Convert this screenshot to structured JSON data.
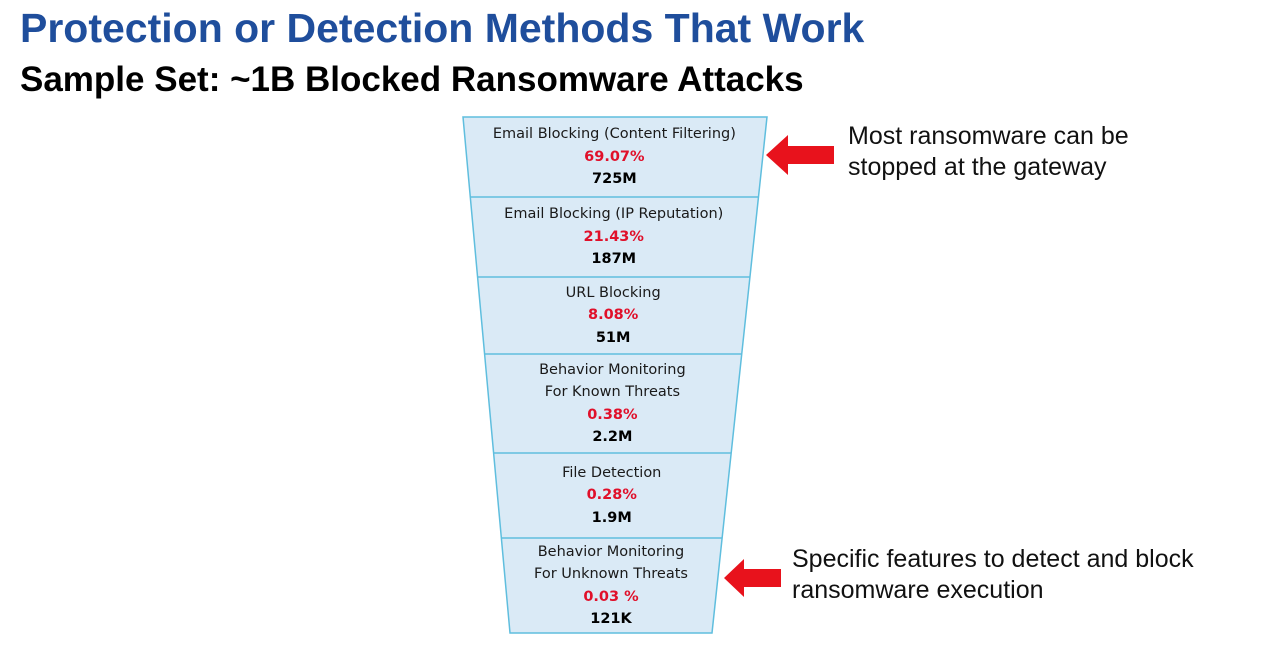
{
  "title": "Protection or Detection Methods That Work",
  "subtitle": "Sample Set: ~1B Blocked Ransomware Attacks",
  "colors": {
    "title": "#1f4e9c",
    "percent": "#e0102a",
    "funnel_fill": "#daeaf6",
    "funnel_line": "#5fbede",
    "arrow": "#e8121c"
  },
  "funnel": [
    {
      "label_lines": [
        "Email Blocking (Content Filtering)"
      ],
      "percent": "69.07%",
      "count": "725M"
    },
    {
      "label_lines": [
        "Email Blocking (IP Reputation)"
      ],
      "percent": "21.43%",
      "count": "187M"
    },
    {
      "label_lines": [
        "URL Blocking"
      ],
      "percent": "8.08%",
      "count": "51M"
    },
    {
      "label_lines": [
        "Behavior Monitoring",
        "For Known Threats"
      ],
      "percent": "0.38%",
      "count": "2.2M"
    },
    {
      "label_lines": [
        "File Detection"
      ],
      "percent": "0.28%",
      "count": "1.9M"
    },
    {
      "label_lines": [
        "Behavior Monitoring",
        "For Unknown Threats"
      ],
      "percent": "0.03 %",
      "count": "121K"
    }
  ],
  "annotations": {
    "gateway": {
      "lines": [
        "Most ransomware can be",
        "stopped at the gateway"
      ],
      "icon": "left-arrow-icon"
    },
    "execution": {
      "lines": [
        "Specific features to detect and block",
        "ransomware execution"
      ],
      "icon": "left-arrow-icon"
    }
  }
}
